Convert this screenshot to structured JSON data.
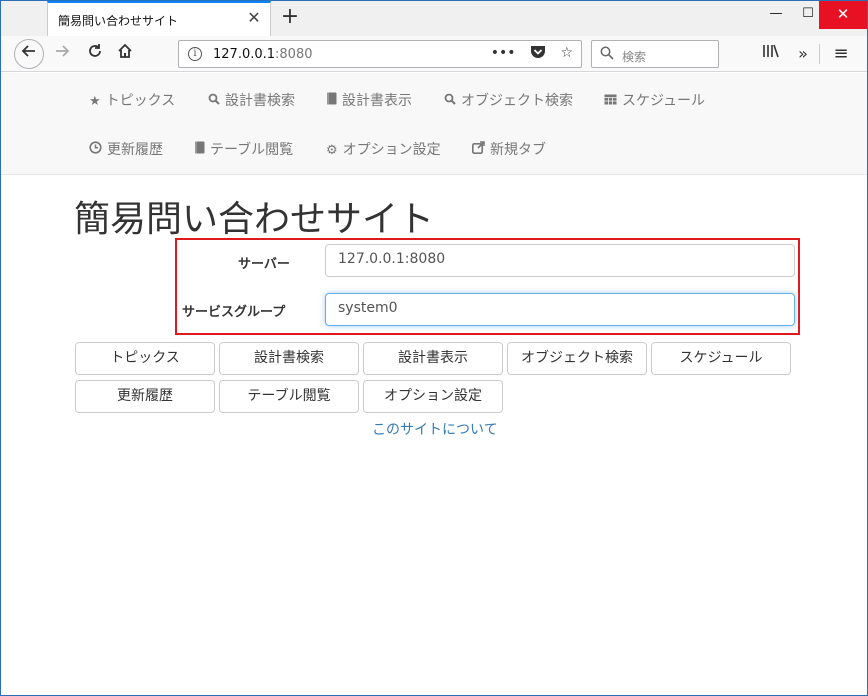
{
  "browser": {
    "tab_title": "簡易問い合わせサイト",
    "tab_close": "✕",
    "new_tab": "+",
    "window_min": "—",
    "window_max": "☐",
    "window_close": "✕",
    "url_host": "127.0.0.1",
    "url_port": ":8080",
    "search_placeholder": "検索",
    "icons": {
      "back": "back-arrow-icon",
      "forward": "forward-arrow-icon",
      "reload": "reload-icon",
      "home": "home-icon",
      "info": "info-icon",
      "page_actions": "more-icon",
      "pocket": "pocket-icon",
      "bookmark": "star-icon",
      "search": "search-icon",
      "library": "library-icon",
      "overflow": "overflow-icon",
      "menu": "hamburger-menu-icon"
    }
  },
  "pagenav": {
    "items": [
      {
        "label": "トピックス",
        "icon": "star-icon"
      },
      {
        "label": "設計書検索",
        "icon": "search-icon"
      },
      {
        "label": "設計書表示",
        "icon": "book-icon"
      },
      {
        "label": "オブジェクト検索",
        "icon": "search-icon"
      },
      {
        "label": "スケジュール",
        "icon": "calendar-icon"
      },
      {
        "label": "更新履歴",
        "icon": "clock-icon"
      },
      {
        "label": "テーブル閲覧",
        "icon": "book-icon"
      },
      {
        "label": "オプション設定",
        "icon": "gear-icon"
      },
      {
        "label": "新規タブ",
        "icon": "external-link-icon"
      }
    ]
  },
  "main": {
    "title": "簡易問い合わせサイト",
    "server_label": "サーバー",
    "server_value": "127.0.0.1:8080",
    "group_label": "サービスグループ",
    "group_value": "system0",
    "buttons": [
      "トピックス",
      "設計書検索",
      "設計書表示",
      "オブジェクト検索",
      "スケジュール",
      "更新履歴",
      "テーブル閲覧",
      "オプション設定"
    ],
    "about_link": "このサイトについて"
  },
  "colors": {
    "highlight_box": "#e0191e",
    "link": "#337ab7",
    "window_close": "#e81123"
  }
}
